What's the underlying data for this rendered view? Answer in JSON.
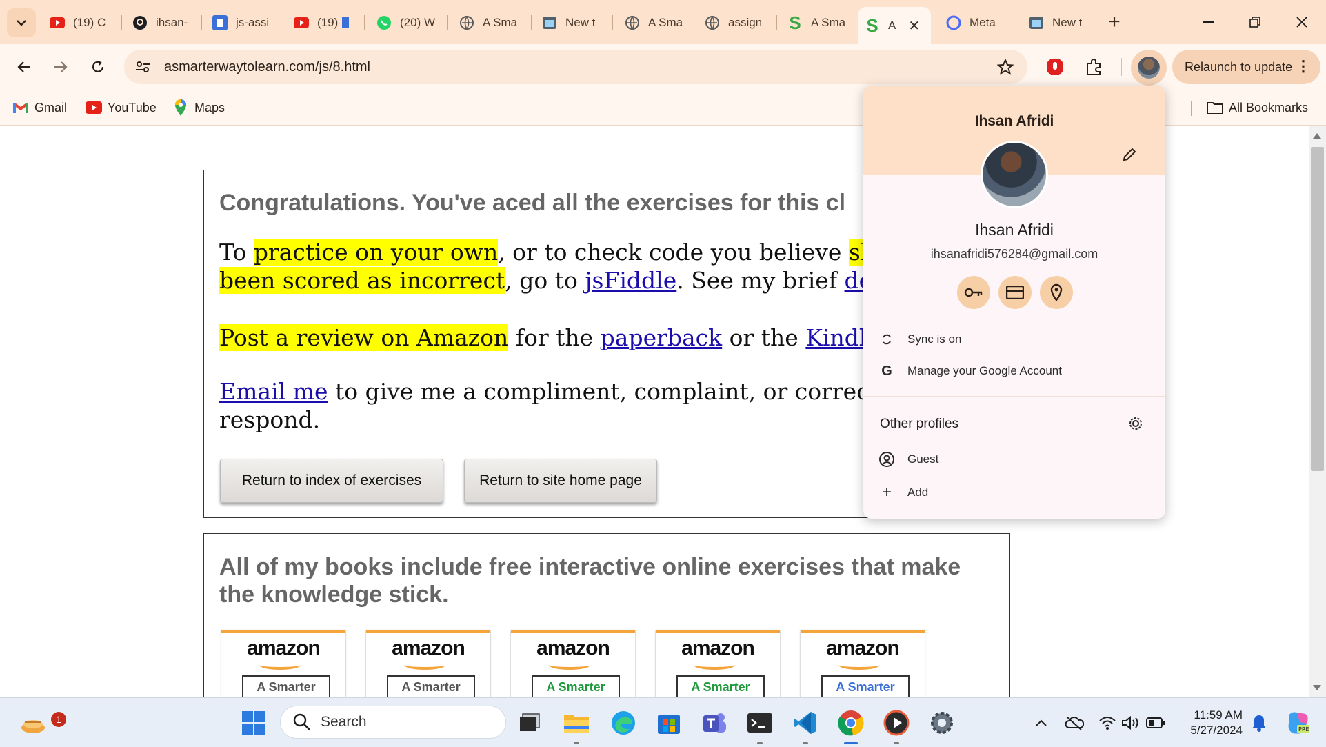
{
  "tabs": [
    {
      "title": "(19) C",
      "icon": "youtube-icon"
    },
    {
      "title": "ihsan-",
      "icon": "github-icon"
    },
    {
      "title": "js-assi",
      "icon": "replit-icon"
    },
    {
      "title": "(19)",
      "icon": "youtube-icon"
    },
    {
      "title": "(20) W",
      "icon": "whatsapp-icon"
    },
    {
      "title": "A Sma",
      "icon": "globe-icon"
    },
    {
      "title": "New t",
      "icon": "newtab-icon"
    },
    {
      "title": "A Sma",
      "icon": "globe-icon"
    },
    {
      "title": "assign",
      "icon": "globe-icon"
    },
    {
      "title": "A Sma",
      "icon": "s-logo-icon"
    },
    {
      "title": "A",
      "icon": "s-logo-icon",
      "active": true
    },
    {
      "title": "Meta",
      "icon": "meta-icon"
    },
    {
      "title": "New t",
      "icon": "newtab-icon"
    }
  ],
  "toolbar": {
    "url": "asmarterwaytolearn.com/js/8.html",
    "relaunch_label": "Relaunch to update"
  },
  "bookmarks": {
    "items": [
      {
        "label": "Gmail",
        "icon": "gmail-icon"
      },
      {
        "label": "YouTube",
        "icon": "youtube-icon"
      },
      {
        "label": "Maps",
        "icon": "maps-icon"
      }
    ],
    "all_label": "All Bookmarks"
  },
  "page": {
    "heading": "Congratulations. You've aced all the exercises for this cl",
    "p1_a": "practice on your own",
    "p1_pre": "To ",
    "p1_b": ", or to check code you believe ",
    "p1_c": "shoul",
    "p1_d": "been scored as incorrect",
    "p1_e": ", go to ",
    "p1_link1": "jsFiddle",
    "p1_f": ". See my brief ",
    "p1_link2": "demo",
    "p2_hl": "Post a review on Amazon",
    "p2_a": " for the ",
    "p2_link1": "paperback",
    "p2_b": " or the ",
    "p2_link2": "Kindle e",
    "p3_link": "Email me",
    "p3_a": " to give me a compliment, complaint, or correctio",
    "p3_b": "respond.",
    "btn_index": "Return to index of exercises",
    "btn_home": "Return to site home page",
    "books_heading": "All of my books include free interactive online exercises that make the knowledge stick.",
    "books": [
      {
        "brand": "amazon",
        "title": "A Smarter Way to",
        "color": "#555555"
      },
      {
        "brand": "amazon",
        "title": "A Smarter Way to",
        "color": "#555555"
      },
      {
        "brand": "amazon",
        "title": "A Smarter Way to",
        "color": "#1e9a3c"
      },
      {
        "brand": "amazon",
        "title": "A Smarter Way to",
        "color": "#1e9a3c"
      },
      {
        "brand": "amazon",
        "title": "A Smarter Way to",
        "color": "#3a6fd8"
      }
    ]
  },
  "profile": {
    "header_name": "Ihsan Afridi",
    "name": "Ihsan Afridi",
    "email": "ihsanafridi576284@gmail.com",
    "sync_label": "Sync is on",
    "manage_label": "Manage your Google Account",
    "other_profiles_label": "Other profiles",
    "guest_label": "Guest",
    "add_label": "Add"
  },
  "taskbar": {
    "search_placeholder": "Search",
    "time": "11:59 AM",
    "date": "5/27/2024",
    "notification_count": "1"
  },
  "colors": {
    "tabstrip_bg": "#fde3cd",
    "highlight": "#ffff00",
    "link": "#1a0dab",
    "profile_banner": "#fde0c7"
  }
}
